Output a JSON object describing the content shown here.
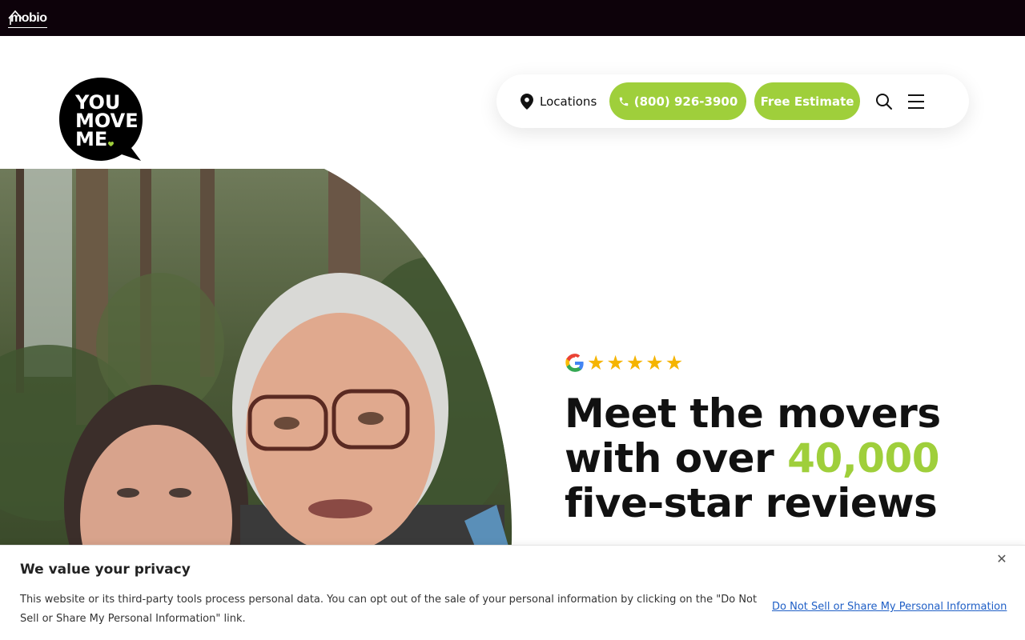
{
  "topbar": {
    "logo_text": "mobio"
  },
  "brand": {
    "logo_lines": [
      "YOU",
      "MOVE",
      "ME"
    ]
  },
  "nav": {
    "locations_label": "Locations",
    "phone_label": "(800) 926-3900",
    "estimate_label": "Free Estimate",
    "icons": [
      "location-pin-icon",
      "phone-icon",
      "search-icon",
      "hamburger-menu-icon"
    ]
  },
  "hero": {
    "rating_stars": 5,
    "rating_source_icon": "google-icon",
    "headline_line1": "Meet the movers",
    "headline_line2_prefix": "with over ",
    "headline_accent": "40,000",
    "headline_line3": "five-star reviews"
  },
  "cookie": {
    "title": "We value your privacy",
    "body": "This website or its third-party tools process personal data. You can opt out of the sale of your personal information by clicking on the \"Do Not Sell or Share My Personal Information\" link.",
    "link_label": "Do Not Sell or Share My Personal Information",
    "close_icon": "close-icon"
  },
  "colors": {
    "topbar_bg": "#0d020a",
    "accent_green": "#9fcf3b",
    "star_gold": "#f5b400",
    "link_blue": "#1f5fc6"
  }
}
